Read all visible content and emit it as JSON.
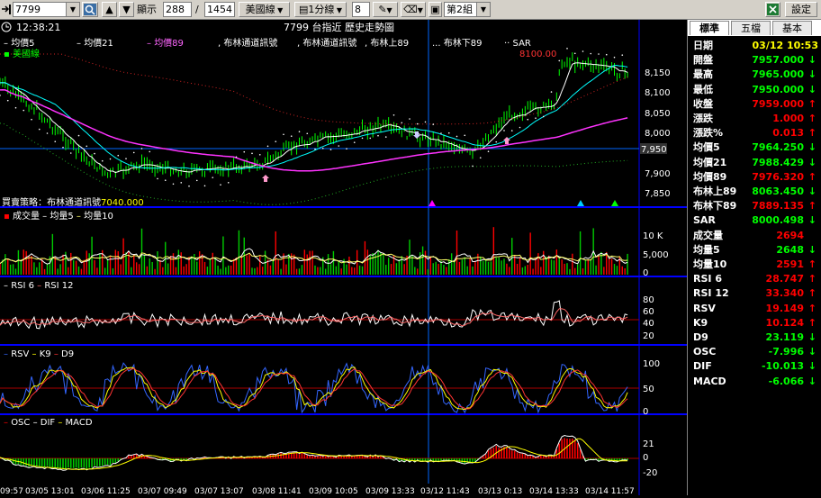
{
  "toolbar": {
    "symbol": "7799",
    "show_label": "顯示",
    "show_value": "288",
    "total_value": "1454",
    "market": "美國線",
    "interval": "1分線",
    "period": "8",
    "group": "第2組",
    "settings_label": "設定"
  },
  "header": {
    "time": "12:38:21",
    "title": "7799 台指近  歷史走勢圖",
    "price_top_label": "8100.00",
    "price_tag": "7,950"
  },
  "legend": {
    "main": [
      "均價5",
      "均價21",
      "均價89",
      "布林通道訊號",
      "布林通道訊號",
      "布林上89",
      "布林下89",
      "SAR"
    ],
    "main_line2": "美國線",
    "strategy": "買賣策略：布林通道訊號",
    "strategy_value": "7040.000",
    "volume": [
      "成交量",
      "均量5",
      "均量10"
    ],
    "rsi": [
      "RSI 6",
      "RSI 12"
    ],
    "kd": [
      "RSV",
      "K9",
      "D9"
    ],
    "macd": [
      "OSC",
      "DIF",
      "MACD"
    ]
  },
  "axes": {
    "price_ticks": [
      "8,150",
      "8,100",
      "8,050",
      "8,000",
      "7,950",
      "7,900",
      "7,850"
    ],
    "volume_ticks": [
      "10 K",
      "5,000",
      "0"
    ],
    "rsi_ticks": [
      "80",
      "60",
      "40",
      "20"
    ],
    "kd_ticks": [
      "100",
      "50",
      "0"
    ],
    "macd_ticks": [
      "21",
      "0",
      "-20"
    ],
    "time_labels": [
      "09:57",
      "03/05 13:01",
      "03/06 11:25",
      "03/07 09:49",
      "03/07 13:07",
      "03/08 11:41",
      "03/09 10:05",
      "03/09 13:33",
      "03/12 11:43",
      "03/13",
      "0:13",
      "03/14 13:33",
      "03/14 11:57"
    ]
  },
  "tabs": [
    "標準",
    "五檔",
    "基本"
  ],
  "quote": [
    {
      "label": "日期",
      "value": "03/12 10:53",
      "color": "#ffff00",
      "arrow": ""
    },
    {
      "label": "開盤",
      "value": "7957.000",
      "color": "#00ff00",
      "arrow": "↓"
    },
    {
      "label": "最高",
      "value": "7965.000",
      "color": "#00ff00",
      "arrow": "↓"
    },
    {
      "label": "最低",
      "value": "7950.000",
      "color": "#00ff00",
      "arrow": "↓"
    },
    {
      "label": "收盤",
      "value": "7959.000",
      "color": "#ff0000",
      "arrow": "↑"
    },
    {
      "label": "漲跌",
      "value": "1.000",
      "color": "#ff0000",
      "arrow": "↑"
    },
    {
      "label": "漲跌%",
      "value": "0.013",
      "color": "#ff0000",
      "arrow": "↑"
    },
    {
      "label": "均價5",
      "value": "7964.250",
      "color": "#00ff00",
      "arrow": "↓"
    },
    {
      "label": "均價21",
      "value": "7988.429",
      "color": "#00ff00",
      "arrow": "↓"
    },
    {
      "label": "均價89",
      "value": "7976.320",
      "color": "#ff0000",
      "arrow": "↑"
    },
    {
      "label": "布林上89",
      "value": "8063.450",
      "color": "#00ff00",
      "arrow": "↓"
    },
    {
      "label": "布林下89",
      "value": "7889.135",
      "color": "#ff0000",
      "arrow": "↑"
    },
    {
      "label": "SAR",
      "value": "8000.498",
      "color": "#00ff00",
      "arrow": "↓"
    },
    {
      "label": "成交量",
      "value": "2694",
      "color": "#ff0000",
      "arrow": ""
    },
    {
      "label": "均量5",
      "value": "2648",
      "color": "#00ff00",
      "arrow": "↓"
    },
    {
      "label": "均量10",
      "value": "2591",
      "color": "#ff0000",
      "arrow": "↑"
    },
    {
      "label": "RSI 6",
      "value": "28.747",
      "color": "#ff0000",
      "arrow": "↑"
    },
    {
      "label": "RSI 12",
      "value": "33.340",
      "color": "#ff0000",
      "arrow": "↑"
    },
    {
      "label": "RSV",
      "value": "19.149",
      "color": "#ff0000",
      "arrow": "↑"
    },
    {
      "label": "K9",
      "value": "10.124",
      "color": "#ff0000",
      "arrow": "↑"
    },
    {
      "label": "D9",
      "value": "23.119",
      "color": "#00ff00",
      "arrow": "↓"
    },
    {
      "label": "OSC",
      "value": "-7.996",
      "color": "#00ff00",
      "arrow": "↓"
    },
    {
      "label": "DIF",
      "value": "-10.013",
      "color": "#00ff00",
      "arrow": "↓"
    },
    {
      "label": "MACD",
      "value": "-6.066",
      "color": "#00ff00",
      "arrow": "↓"
    }
  ],
  "colors": {
    "ma5": "#ffffff",
    "ma21": "#00ffff",
    "ma89": "#ff00ff",
    "boll_up": "#ff3333",
    "boll_dn": "#33cc33",
    "sar": "#ffffff",
    "candle": "#00ff00",
    "panel_border": "#0000ff"
  }
}
